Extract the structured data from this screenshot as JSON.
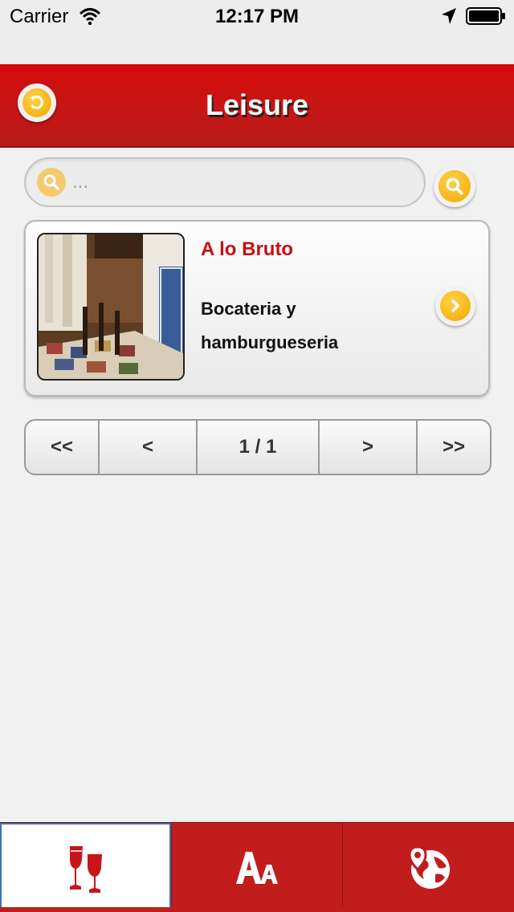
{
  "status_bar": {
    "carrier": "Carrier",
    "time": "12:17 PM",
    "icons": [
      "wifi-icon",
      "location-arrow-icon",
      "battery-icon"
    ]
  },
  "header": {
    "title": "Leisure",
    "back_icon": "undo-arrow-icon",
    "background_color": "#c61616"
  },
  "search": {
    "placeholder": "...",
    "value": "",
    "icon": "magnifier-icon",
    "accent_color": "#f2a800"
  },
  "results": [
    {
      "title": "A lo Bruto",
      "description": "Bocateria y hamburgueseria",
      "image": "restaurant-dining-room-photo",
      "action_icon": "chevron-right-icon"
    }
  ],
  "pagination": {
    "first_label": "<<",
    "prev_label": "<",
    "page_info": "1 / 1",
    "next_label": ">",
    "last_label": ">>"
  },
  "tab_bar": {
    "tabs": [
      {
        "icon": "wine-glasses-icon",
        "selected": true
      },
      {
        "icon": "font-size-icon",
        "selected": false
      },
      {
        "icon": "map-globe-pin-icon",
        "selected": false
      }
    ],
    "color": "#c11d1d"
  }
}
